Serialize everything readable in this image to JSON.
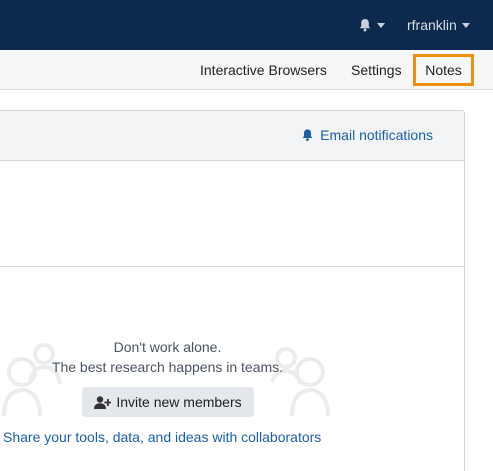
{
  "topbar": {
    "notifications_icon": "bell-icon",
    "user_name": "rfranklin"
  },
  "subnav": {
    "items": [
      {
        "label": "Interactive Browsers"
      },
      {
        "label": "Settings"
      },
      {
        "label": "Notes",
        "highlighted": true
      }
    ],
    "highlight_color": "#f0900f"
  },
  "panel": {
    "email_notifications_label": "Email notifications"
  },
  "empty_state": {
    "line1": "Don't work alone.",
    "line2": "The best research happens in teams.",
    "invite_button_label": "Invite new members",
    "invite_icon": "user-plus-icon",
    "share_link": "Share your tools, data, and ideas with collaborators"
  },
  "colors": {
    "topbar": "#0d2a4e",
    "link": "#1c5fa8",
    "highlight": "#f0900f"
  }
}
